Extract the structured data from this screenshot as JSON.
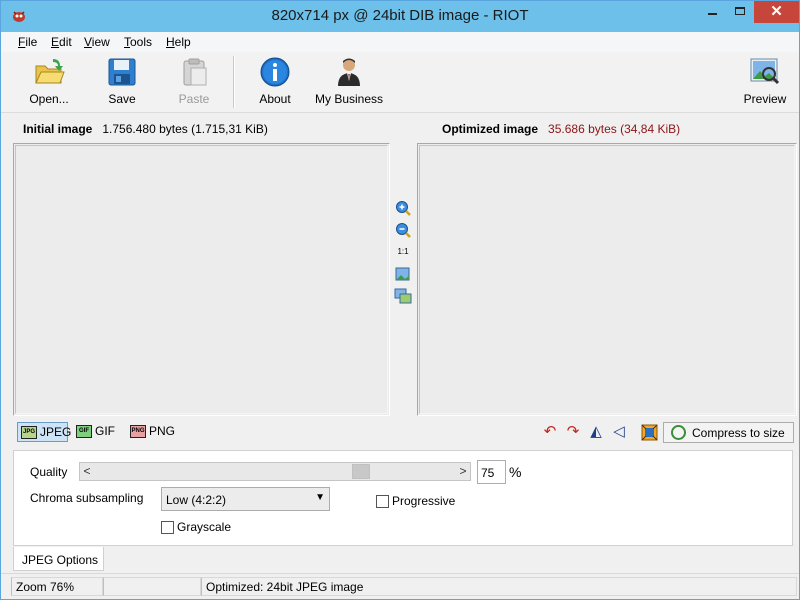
{
  "window": {
    "title": "820x714 px @ 24bit  DIB image - RIOT",
    "minimize_glyph": "—",
    "maximize_glyph": "☐",
    "close_glyph": "✕"
  },
  "menu": {
    "items": [
      {
        "label": "File",
        "accel": "F"
      },
      {
        "label": "Edit",
        "accel": "E"
      },
      {
        "label": "View",
        "accel": "V"
      },
      {
        "label": "Tools",
        "accel": "T"
      },
      {
        "label": "Help",
        "accel": "H"
      }
    ]
  },
  "toolbar": {
    "open": "Open...",
    "save": "Save",
    "paste": "Paste",
    "about": "About",
    "my_business": "My Business",
    "preview": "Preview"
  },
  "initial": {
    "label": "Initial image",
    "size": "1.756.480 bytes (1.715,31 KiB)"
  },
  "optimized": {
    "label": "Optimized image",
    "size": "35.686 bytes (34,84 KiB)"
  },
  "zoom_tools": {
    "zoom_in": "zoom-in-icon",
    "zoom_out": "zoom-out-icon",
    "actual_size": "1:1",
    "fit": "fit-image-icon",
    "compare": "compare-icon"
  },
  "formats": {
    "jpeg": "JPEG",
    "gif": "GIF",
    "png": "PNG",
    "active": "JPEG"
  },
  "image_tools": {
    "rotate_ccw": "↶",
    "rotate_cw": "↷",
    "flip_h": "◭",
    "flip_v": "◁"
  },
  "compress": {
    "label": "Compress to size"
  },
  "options": {
    "quality_label": "Quality",
    "quality_value": "75",
    "quality_unit": "%",
    "quality_fraction": 0.75,
    "chroma_label": "Chroma subsampling",
    "chroma_value": "Low (4:2:2)",
    "progressive_label": "Progressive",
    "progressive_checked": false,
    "grayscale_label": "Grayscale",
    "grayscale_checked": false
  },
  "options_tab": "JPEG Options",
  "status": {
    "zoom": "Zoom 76%",
    "message": "Optimized: 24bit JPEG image"
  },
  "colors": {
    "titlebar": "#6cc0ea",
    "close": "#c7463b",
    "optimized_size": "#8c1414",
    "active_tab": "#cde3f6"
  }
}
